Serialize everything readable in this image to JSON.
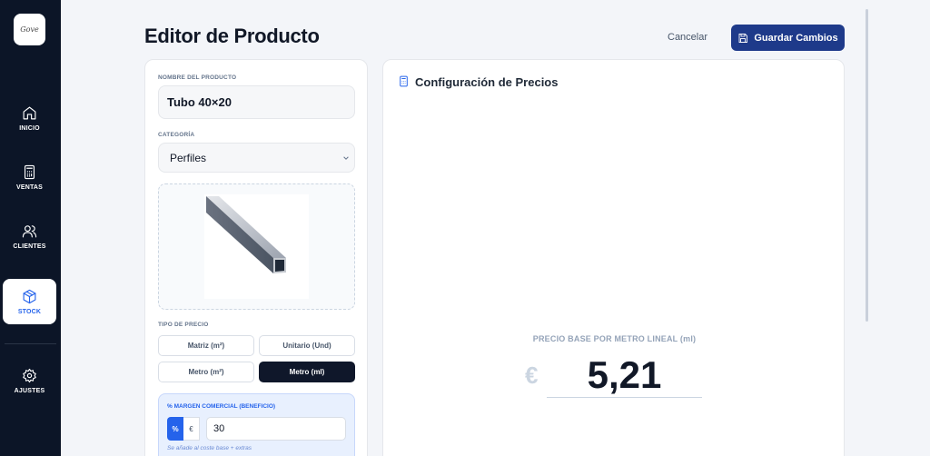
{
  "app": {
    "logo_text": "Gove"
  },
  "sidebar": {
    "items": [
      {
        "label": "INICIO",
        "icon": "home-icon"
      },
      {
        "label": "VENTAS",
        "icon": "calculator-icon"
      },
      {
        "label": "CLIENTES",
        "icon": "users-icon"
      },
      {
        "label": "STOCK",
        "icon": "package-icon",
        "active": true
      },
      {
        "label": "AJUSTES",
        "icon": "gear-icon"
      }
    ]
  },
  "header": {
    "title": "Editor de Producto",
    "cancel_label": "Cancelar",
    "save_label": "Guardar Cambios"
  },
  "form": {
    "name_label": "NOMBRE DEL PRODUCTO",
    "name_value": "Tubo 40×20",
    "category_label": "CATEGORÍA",
    "category_value": "Perfiles",
    "price_type_label": "TIPO DE PRECIO",
    "price_types": [
      "Matriz (m²)",
      "Unitario (Und)",
      "Metro (m²)",
      "Metro (ml)"
    ],
    "price_type_selected": "Metro (ml)",
    "margin_label": "% MARGEN COMERCIAL (BENEFICIO)",
    "margin_pct_label": "%",
    "margin_eur_label": "€",
    "margin_value": "30",
    "margin_hint": "Se añade al coste base + extras"
  },
  "pricing": {
    "title": "Configuración de Precios",
    "base_label": "PRECIO BASE POR METRO LINEAL (ml)",
    "currency": "€",
    "base_value": "5,21"
  },
  "colors": {
    "sidebar": "#0c1527",
    "accent": "#2563eb",
    "primary_button": "#1e3a8a"
  }
}
